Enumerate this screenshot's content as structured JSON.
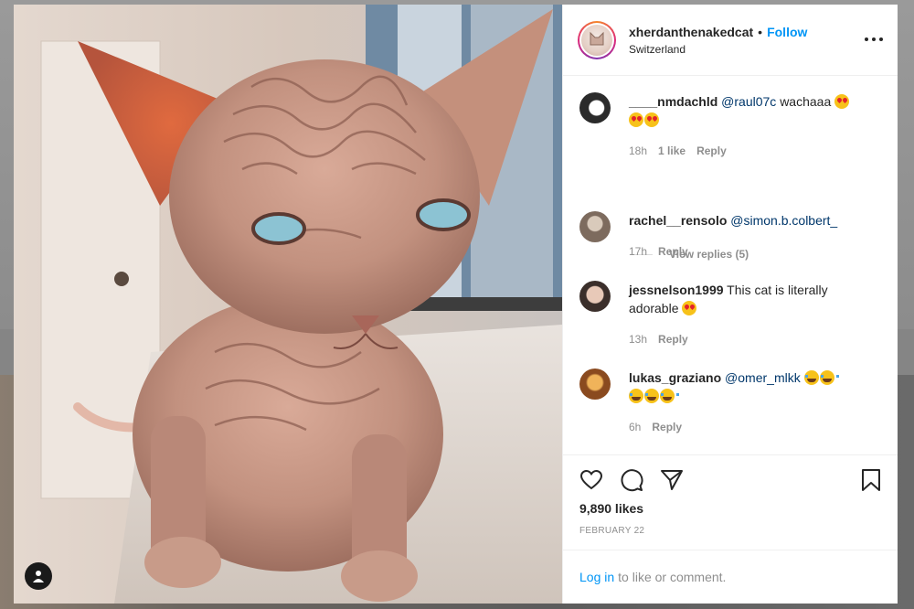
{
  "post": {
    "username": "xherdanthenakedcat",
    "separator": "•",
    "follow_label": "Follow",
    "location": "Switzerland",
    "likes": "9,890 likes",
    "date": "FEBRUARY 22"
  },
  "comments": [
    {
      "user": "____nmdachld",
      "mention": "@raul07c",
      "text": "wachaaa",
      "emoji_line1": [
        "heart-eyes"
      ],
      "emoji_line2": [
        "heart-eyes",
        "heart-eyes"
      ],
      "time": "18h",
      "likes": "1 like",
      "reply": "Reply",
      "view_replies": "View replies (5)"
    },
    {
      "user": "rachel__rensolo",
      "mention": "@simon.b.colbert_",
      "text": "",
      "time": "17h",
      "reply": "Reply"
    },
    {
      "user": "jessnelson1999",
      "mention": "",
      "text": "This cat is literally",
      "text_line2": "adorable",
      "time": "13h",
      "reply": "Reply"
    },
    {
      "user": "lukas_graziano",
      "mention": "@omer_mlkk",
      "text": "",
      "time": "6h",
      "reply": "Reply"
    }
  ],
  "footer": {
    "login_link": "Log in",
    "login_text": "to like or comment."
  },
  "icons": {
    "more": "more-options-icon",
    "like": "heart-icon",
    "comment": "comment-bubble-icon",
    "share": "paper-plane-icon",
    "save": "bookmark-icon",
    "user": "user-tag-icon"
  },
  "colors": {
    "accent": "#0095f6",
    "text": "#262626",
    "muted": "#8e8e8e",
    "mention": "#00376b"
  }
}
